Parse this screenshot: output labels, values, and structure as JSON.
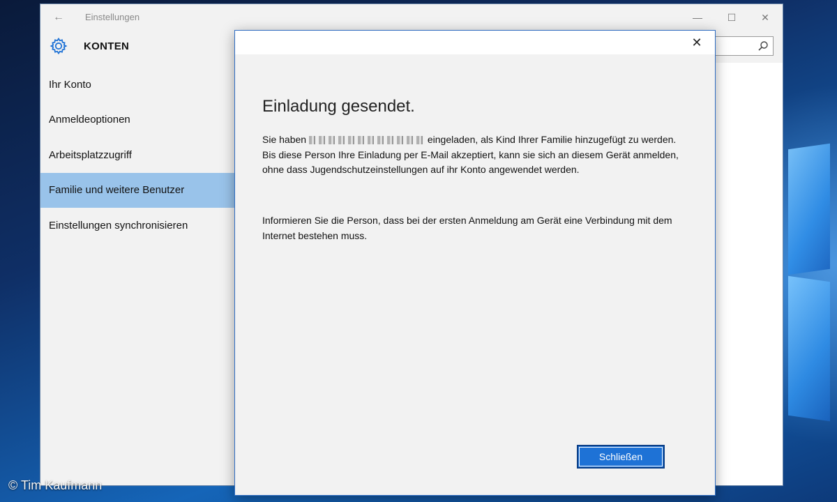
{
  "window": {
    "title": "Einstellungen",
    "back_icon": "back-arrow-icon",
    "minimize_icon": "minimize-icon",
    "maximize_icon": "maximize-icon",
    "close_icon": "close-icon"
  },
  "header": {
    "section_icon": "gear-icon",
    "section_title": "KONTEN",
    "search_icon": "search-icon",
    "search_value": ""
  },
  "sidebar": {
    "items": [
      {
        "label": "Ihr Konto",
        "active": false
      },
      {
        "label": "Anmeldeoptionen",
        "active": false
      },
      {
        "label": "Arbeitsplatzzugriff",
        "active": false
      },
      {
        "label": "Familie und weitere Benutzer",
        "active": true
      },
      {
        "label": "Einstellungen synchronisieren",
        "active": false
      }
    ]
  },
  "dialog": {
    "close_icon": "close-icon",
    "title": "Einladung gesendet.",
    "paragraph1_prefix": "Sie haben",
    "paragraph1_suffix": "eingeladen, als Kind Ihrer Familie hinzugefügt zu werden. Bis diese Person Ihre Einladung per E-Mail akzeptiert, kann sie sich an diesem Gerät anmelden, ohne dass Jugendschutzeinstellungen auf ihr Konto angewendet werden.",
    "paragraph2": "Informieren Sie die Person, dass bei der ersten Anmeldung am Gerät eine Verbindung mit dem Internet bestehen muss.",
    "button_label": "Schließen"
  },
  "colors": {
    "accent": "#1e72d6",
    "sidebar_active": "#99c3ea",
    "panel_bg": "#f2f2f2"
  },
  "watermark": "© Tim Kaufmann"
}
